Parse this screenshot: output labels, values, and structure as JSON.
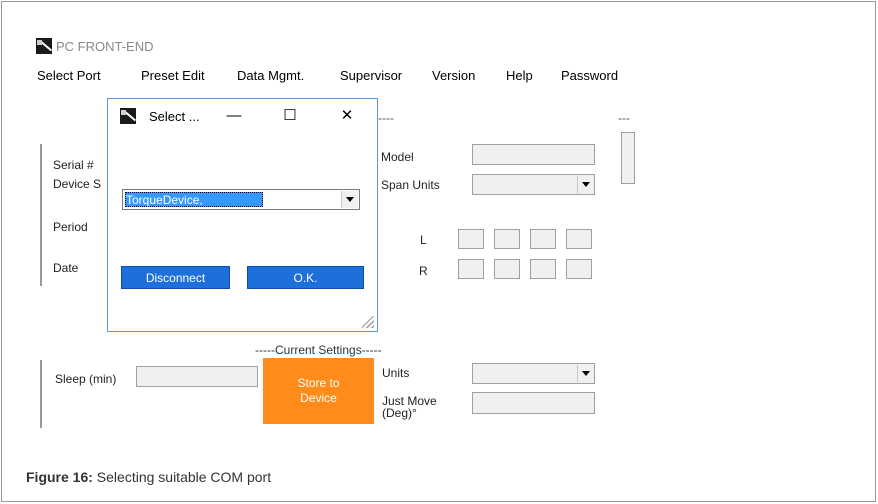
{
  "app": {
    "title": "PC FRONT-END"
  },
  "menu": [
    {
      "label": "Select Port"
    },
    {
      "label": "Preset Edit"
    },
    {
      "label": "Data Mgmt."
    },
    {
      "label": "Supervisor"
    },
    {
      "label": "Version"
    },
    {
      "label": "Help"
    },
    {
      "label": "Password"
    }
  ],
  "background": {
    "dashes_top": "-----",
    "dashes_right": "---",
    "left_labels": {
      "serial": "Serial #",
      "device": "Device S",
      "period": "Period",
      "date": "Date"
    },
    "model_label": "Model",
    "span_units_label": "Span Units",
    "l_label": "L",
    "r_label": "R",
    "current_settings": "-----Current Settings-----",
    "sleep_label": "Sleep (min)",
    "units_label": "Units",
    "just_move_label": "Just Move\n(Deg)°",
    "store_button": "Store to\nDevice"
  },
  "dialog": {
    "title": "Select ...",
    "combo_value": "TorqueDevice,",
    "disconnect_label": "Disconnect",
    "ok_label": "O.K."
  },
  "caption": {
    "figure": "Figure 16:",
    "text": "Selecting suitable COM port"
  },
  "colors": {
    "accent_blue": "#1e6fd9",
    "store_orange": "#ff8c1a",
    "selection_blue": "#3399ff"
  }
}
